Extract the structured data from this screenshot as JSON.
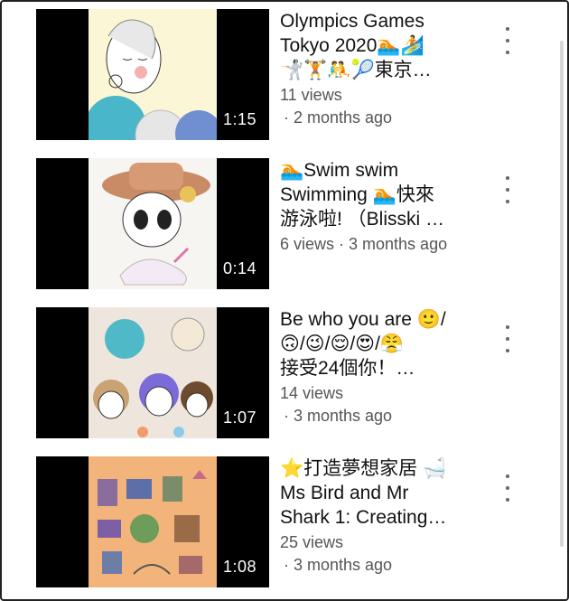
{
  "videos": [
    {
      "title_lines": [
        "Olympics Games",
        "Tokyo 2020🏊🏄",
        "🤺🏋🤼🎾東京…"
      ],
      "views": "11 views",
      "time_line": "· 2 months ago",
      "duration": "1:15",
      "thumb_bg": "#f6efc8"
    },
    {
      "title_lines": [
        "🏊Swim swim",
        "Swimming 🏊快來",
        "游泳啦! （Blisski …"
      ],
      "views": "6 views · 3 months ago",
      "time_line": "",
      "duration": "0:14",
      "thumb_bg": "#f7f5f2"
    },
    {
      "title_lines": [
        "Be who you are 🙂/",
        "🙃/😉/😌/😍/😤",
        "接受24個你！…"
      ],
      "views": "14 views",
      "time_line": "· 3 months ago",
      "duration": "1:07",
      "thumb_bg": "#eee6dc"
    },
    {
      "title_lines": [
        "⭐打造夢想家居 🛁",
        "Ms Bird and Mr",
        "Shark 1: Creating…"
      ],
      "views": "25 views",
      "time_line": "· 3 months ago",
      "duration": "1:08",
      "thumb_bg": "#f2b47a"
    }
  ],
  "icons": {
    "menu": "more-vert-icon"
  }
}
